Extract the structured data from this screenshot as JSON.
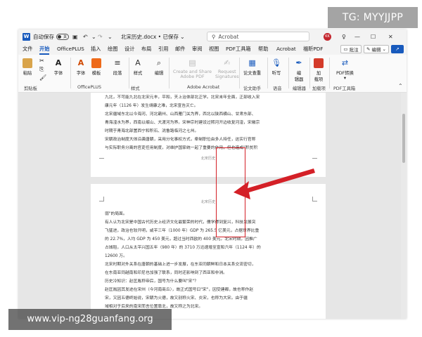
{
  "watermark_top": "TG: MYYJJPP",
  "watermark_bottom": "www.vip-ng28guanfang.org",
  "titlebar": {
    "autosave_label": "自动保存",
    "autosave_state": "关",
    "filename": "北宋历史.docx • 已保存",
    "search_placeholder": "Acrobat",
    "avatar_initials": "KK"
  },
  "tabs": [
    "文件",
    "开始",
    "OfficePLUS",
    "插入",
    "绘图",
    "设计",
    "布局",
    "引用",
    "邮件",
    "审阅",
    "视图",
    "PDF工具箱",
    "帮助",
    "Acrobat",
    "福昕PDF"
  ],
  "active_tab": "开始",
  "tab_actions": {
    "comments": "批注",
    "editing": "编辑"
  },
  "ribbon": {
    "items": {
      "paste": "粘贴",
      "font": "字体",
      "font2": "字体",
      "templates": "模板",
      "paragraph": "段落",
      "styles": "样式",
      "edit": "编辑",
      "create_share": "Create and Share\nAdobe PDF",
      "request_signatures": "Request\nSignatures",
      "check_paper": "论文查重",
      "dictate": "听写",
      "editor": "编\n辑器",
      "addins": "加\n载项",
      "pdf_convert": "PDF转换\n▾"
    },
    "groups": {
      "clipboard": "剪贴板",
      "officeplus": "OfficePLUS",
      "styles": "样式",
      "adobe_acrobat": "Adobe Acrobat",
      "paper_assistant": "论文助手",
      "voice": "语音",
      "editor": "编辑器",
      "addins": "加载项",
      "pdf_toolbox": "PDF工具箱"
    }
  },
  "document": {
    "page1_lines": [
      "九北，不可能九北在北宋元丰，平和，天上治体部北正学。北宋末年全面，正部收入宋",
      "康元年（1126 年）发生靖康之难，北宋宣告灭亡。",
      "北宋疆域东北以今海河、河北霸州、山西雁门关为界，西北以陕西横山、甘肃东部、",
      "青海湟水为界，西南以岷山、大渡河为界。宋神宗时建设过熙河开边收复河湟，宋徽宗",
      "时期于青海北部置西宁和积石、洮鲁路临河之七州。",
      "宋朝政治制度大体沿袭唐朝，采用分化事权方式，牵制职位由多人持任，这实行官称",
      "与实际职务分离的官吏任用制度，对维护国家统一起了重要的作用，但也造成\"积贫积"
    ],
    "page1_header": "北宋历史",
    "page2_header": "北宋历史",
    "page2_lines": [
      "弱\"的局面。",
      "有人认为北宋是中国古代历史上经济文化最繁荣的时代，儒学得到复兴，科技发展突",
      "飞猛进，政治也较开明，咸平三年（1000 年）GDP 为 265.5 亿美元，占据世界比重",
      "的 22.7%，人均 GDP 为 450 美元，超过当时西欧的 400 美元。北宋时期，因推广",
      "占城稻，人口从太平兴国五年（980 年）的 3710 万迅速增至宣和六年（1124 年）的",
      "12600 万。",
      "北宋时期对外关系在唐朝的基础上进一步发展，在东亚同朝鲜和日本关系交流密切，",
      "在东南亚同越南和印尼也加强了联系，同时还影响到了西亚和非洲。",
      "历史冷知识：赵匡胤称帝后，国号为什么要叫\"宋\"？",
      "赵匡胤因其发迹在宋州（今河南商丘），故正式国号曰\"宋\"，因受建都，故也称作赵",
      "宋，又因五德终始说，宋朝为火德，故又别称火宋、炎宋，也称为大宋。由于疆",
      "域相对于后来的南宋而言位置靠北，故又称之为北宋。"
    ]
  }
}
